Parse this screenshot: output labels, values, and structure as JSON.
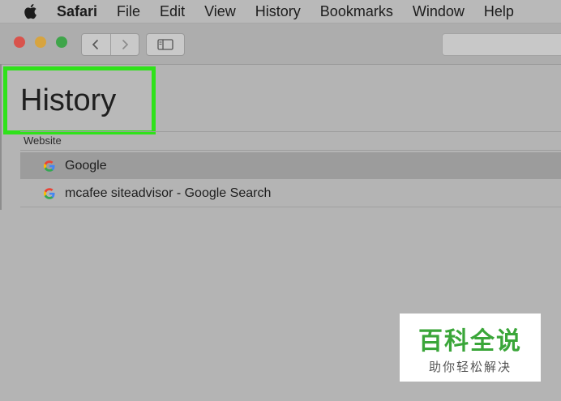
{
  "menubar": {
    "app": "Safari",
    "items": [
      "File",
      "Edit",
      "View",
      "History",
      "Bookmarks",
      "Window",
      "Help"
    ]
  },
  "page": {
    "title": "History",
    "column_header": "Website"
  },
  "history": [
    {
      "label": "Google",
      "icon": "google-g-icon",
      "selected": true
    },
    {
      "label": "mcafee siteadvisor - Google Search",
      "icon": "google-g-icon",
      "selected": false
    }
  ],
  "watermark": {
    "title": "百科全说",
    "subtitle": "助你轻松解决"
  },
  "colors": {
    "highlight_box": "#2fe21a",
    "close": "#d9534c",
    "minimize": "#d7a43f",
    "maximize": "#3fa54a",
    "watermark_green": "#3aa639"
  }
}
